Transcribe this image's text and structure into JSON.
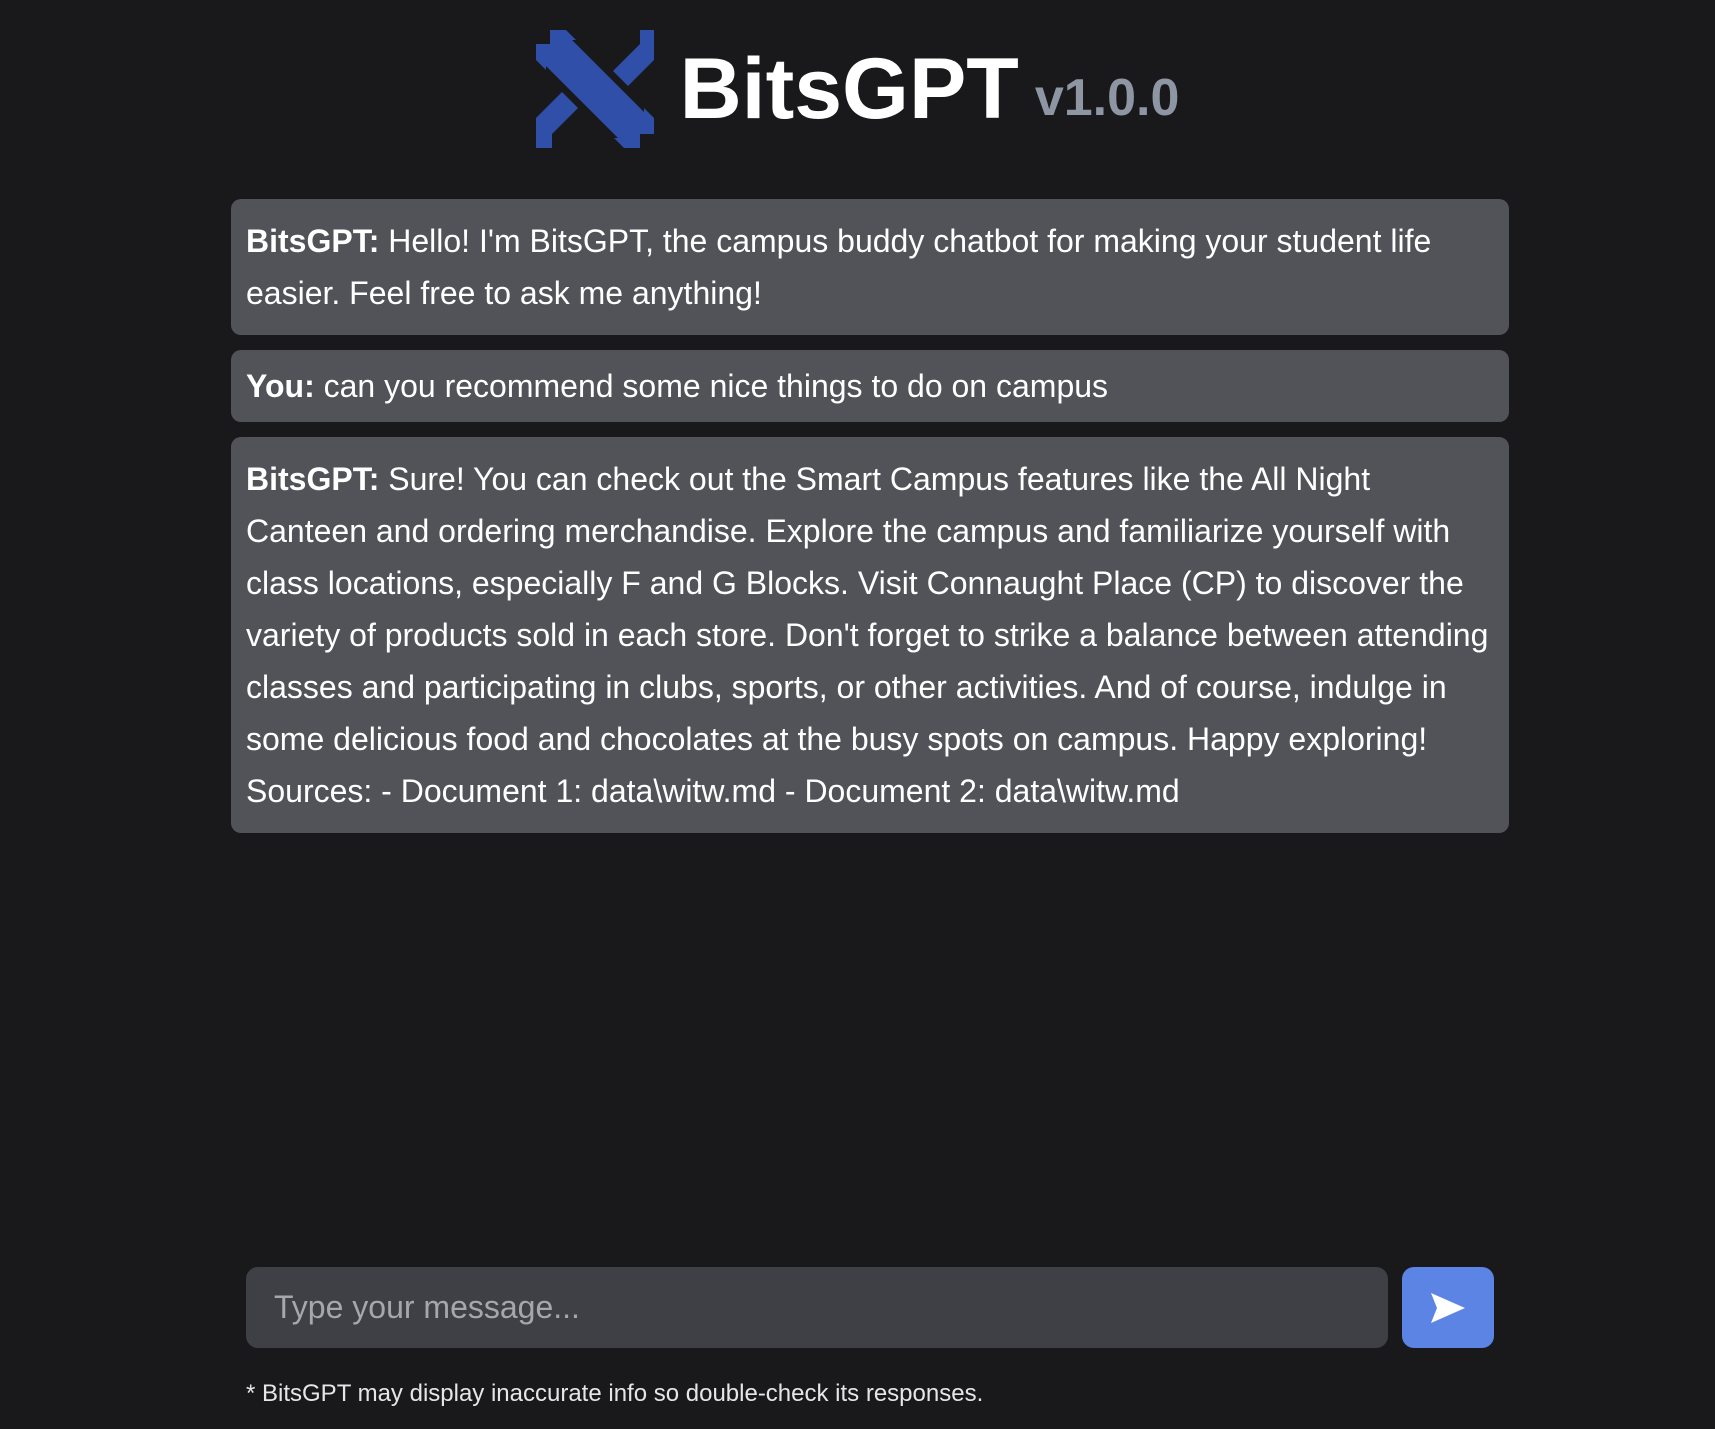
{
  "header": {
    "brand": "BitsGPT",
    "version": "v1.0.0",
    "logo_icon": "crossed-x-logo"
  },
  "messages": [
    {
      "sender": "BitsGPT:",
      "text": " Hello! I'm BitsGPT, the campus buddy chatbot for making your student life easier. Feel free to ask me anything!"
    },
    {
      "sender": "You:",
      "text": " can you recommend some nice things to do on campus"
    },
    {
      "sender": "BitsGPT:",
      "text": " Sure! You can check out the Smart Campus features like the All Night Canteen and ordering merchandise. Explore the campus and familiarize yourself with class locations, especially F and G Blocks. Visit Connaught Place (CP) to discover the variety of products sold in each store. Don't forget to strike a balance between attending classes and participating in clubs, sports, or other activities. And of course, indulge in some delicious food and chocolates at the busy spots on campus. Happy exploring! Sources: - Document 1: data\\witw.md - Document 2: data\\witw.md"
    }
  ],
  "composer": {
    "placeholder": "Type your message...",
    "value": "",
    "send_icon": "send-arrow-icon"
  },
  "disclaimer": "* BitsGPT may display inaccurate info so double-check its responses.",
  "colors": {
    "background": "#19191c",
    "message_bg": "#525359",
    "input_bg": "#3f4045",
    "accent": "#5b84e5",
    "logo_blue": "#2f4fa8",
    "version_gray": "#8f96a3"
  }
}
